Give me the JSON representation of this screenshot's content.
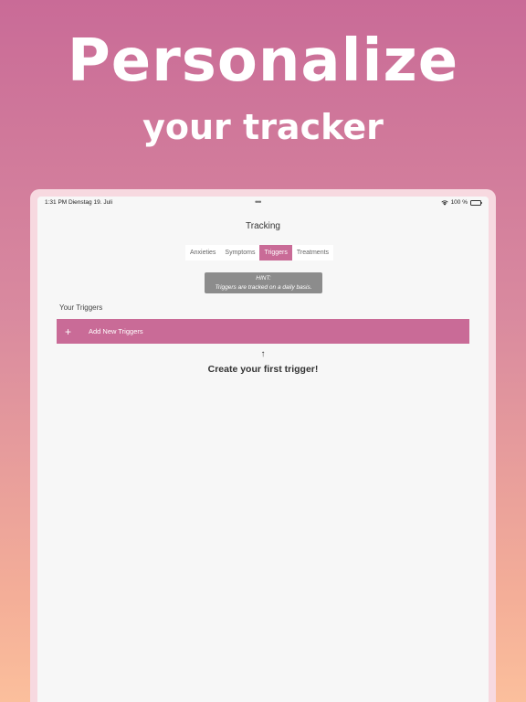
{
  "hero": {
    "title": "Personalize",
    "subtitle": "your tracker"
  },
  "status_bar": {
    "time_date": "1:31 PM   Dienstag 19. Juli",
    "dots": "•••",
    "battery_percent": "100 %"
  },
  "nav": {
    "title": "Tracking"
  },
  "tabs": [
    {
      "label": "Anxieties",
      "active": false
    },
    {
      "label": "Symptoms",
      "active": false
    },
    {
      "label": "Triggers",
      "active": true
    },
    {
      "label": "Treatments",
      "active": false
    }
  ],
  "hint": {
    "heading": "HINT:",
    "text": "Triggers are tracked on a daily basis."
  },
  "section": {
    "label": "Your Triggers"
  },
  "add_button": {
    "icon": "+",
    "label": "Add New Triggers"
  },
  "empty_state": {
    "arrow": "↑",
    "message": "Create your first trigger!"
  },
  "colors": {
    "accent": "#c96b97",
    "hint_bg": "#8c8c8c",
    "screen_bg": "#f7f7f7"
  }
}
